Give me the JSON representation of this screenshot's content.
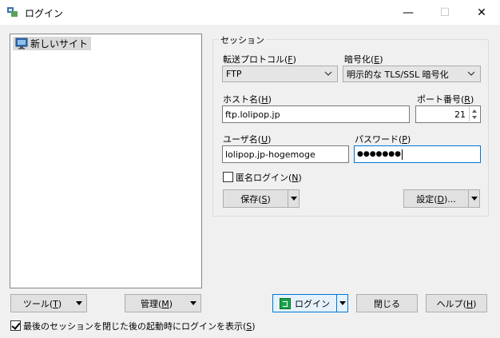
{
  "window": {
    "title": "ログイン",
    "icon": "winscp-app-icon",
    "controls": {
      "minimize": "—",
      "maximize": "☐",
      "close": "✕"
    }
  },
  "site_tree": {
    "items": [
      {
        "label": "新しいサイト",
        "icon": "monitor-icon",
        "selected": true
      }
    ]
  },
  "session": {
    "group_label": "セッション",
    "protocol": {
      "label": "転送プロトコル",
      "accel": "F",
      "value": "FTP"
    },
    "encryption": {
      "label": "暗号化",
      "accel": "E",
      "value": "明示的な TLS/SSL 暗号化"
    },
    "host": {
      "label": "ホスト名",
      "accel": "H",
      "value": "ftp.lolipop.jp"
    },
    "port": {
      "label": "ポート番号",
      "accel": "R",
      "value": "21"
    },
    "user": {
      "label": "ユーザ名",
      "accel": "U",
      "value": "lolipop.jp-hogemoge"
    },
    "password": {
      "label": "パスワード",
      "accel": "P",
      "value": "●●●●●●●"
    },
    "anonymous": {
      "label": "匿名ログイン",
      "accel": "N",
      "checked": false
    },
    "save_button": {
      "label": "保存",
      "accel": "S"
    },
    "settings_button": {
      "label": "設定",
      "accel": "D",
      "suffix": "..."
    }
  },
  "bottom": {
    "tools_button": {
      "label": "ツール",
      "accel": "T"
    },
    "manage_button": {
      "label": "管理",
      "accel": "M"
    },
    "login_button": {
      "label": "ログイン"
    },
    "close_button": {
      "label": "閉じる"
    },
    "help_button": {
      "label": "ヘルプ",
      "accel": "H"
    },
    "show_on_start": {
      "label": "最後のセッションを閉じた後の起動時にログインを表示",
      "accel": "S",
      "checked": true
    }
  },
  "colors": {
    "focus_border": "#0078d7",
    "window_bg": "#f0f0f0",
    "selected_item": "#d9d9d9"
  }
}
